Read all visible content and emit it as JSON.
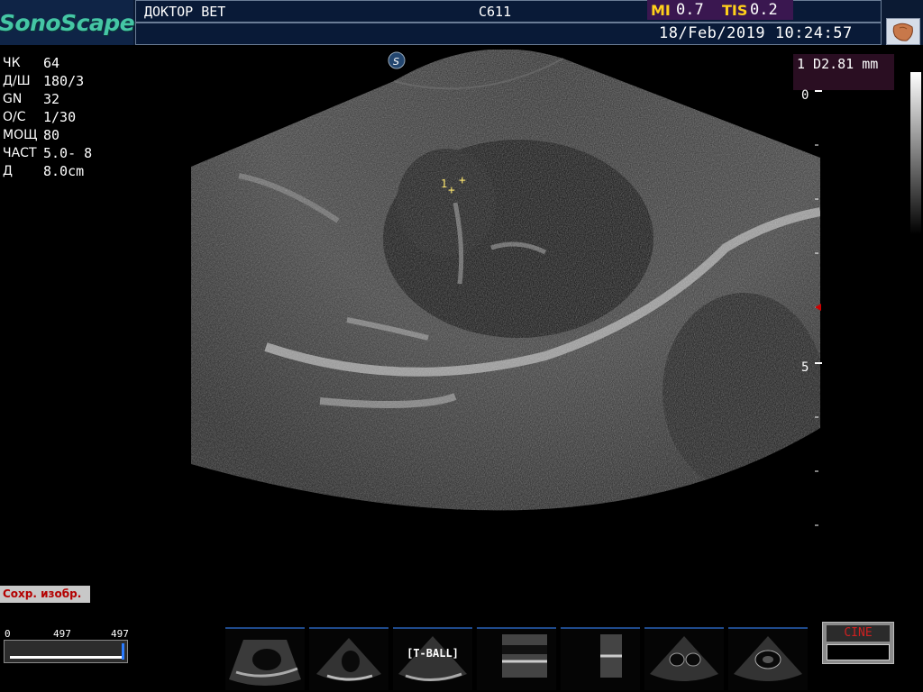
{
  "header": {
    "logo": "SonoScape",
    "hospital": "ДОКТОР ВЕТ",
    "probe": "C611",
    "mi_label": "MI",
    "mi_value": "0.7",
    "tis_label": "TIS",
    "tis_value": "0.2",
    "datetime": "18/Feb/2019 10:24:57"
  },
  "params": [
    {
      "label": "ЧК",
      "value": " 64"
    },
    {
      "label": "Д/Ш",
      "value": "180/3"
    },
    {
      "label": "GN",
      "value": "32"
    },
    {
      "label": "О/С",
      "value": "1/30"
    },
    {
      "label": "МОЩ",
      "value": "80"
    },
    {
      "label": "ЧАСТ",
      "value": "5.0- 8"
    },
    {
      "label": "Д",
      "value": "8.0cm"
    }
  ],
  "measurement": {
    "text": "1 D2.81 mm",
    "marker_label": "1"
  },
  "depth_scale": {
    "top_label": "0",
    "mid_label": "5"
  },
  "save_button": "Сохр. изобр.",
  "cine_slider": {
    "min": "0",
    "mid": "497",
    "max": "497"
  },
  "thumbnails": [
    {
      "label": ""
    },
    {
      "label": ""
    },
    {
      "label": "[T-BALL]"
    },
    {
      "label": ""
    },
    {
      "label": ""
    },
    {
      "label": ""
    },
    {
      "label": ""
    }
  ],
  "cine_button": "CINE",
  "colors": {
    "logo": "#45c6a5",
    "mi_label": "#ffd01a",
    "header_bg": "#0b1a33",
    "cine_text": "#d02020"
  }
}
